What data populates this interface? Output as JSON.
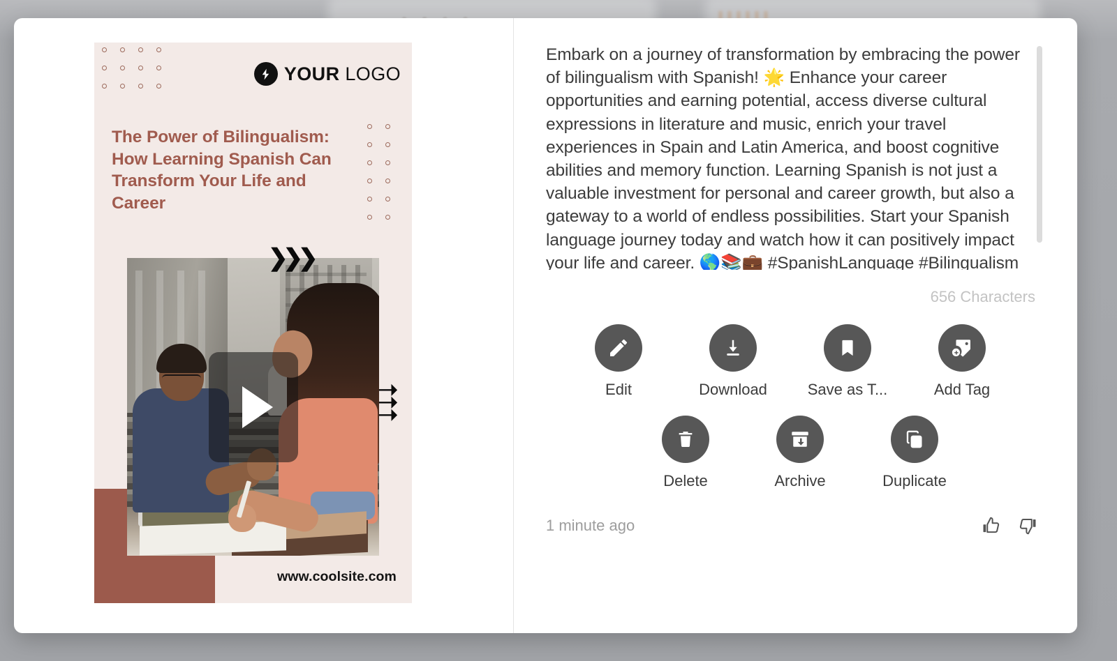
{
  "poster": {
    "logo": {
      "icon": "bolt-circle-icon",
      "bold_word": "YOUR",
      "light_word": "LOGO"
    },
    "headline": "The Power of Bilingualism: How Learning Spanish Can Transform Your Life and Career",
    "url": "www.coolsite.com",
    "play_button_label": "play-video",
    "colors": {
      "background": "#f3eae7",
      "headline": "#a05b4e",
      "block": "#9c5a4c",
      "dots": "#9c6a5c"
    }
  },
  "caption": {
    "text": "Embark on a journey of transformation by embracing the power of bilingualism with Spanish! 🌟 Enhance your career opportunities and earning potential, access diverse cultural expressions in literature and music, enrich your travel experiences in Spain and Latin America, and boost cognitive abilities and memory function. Learning Spanish is not just a valuable investment for personal and career growth, but also a gateway to a world of endless possibilities. Start your Spanish language journey today and watch how it can positively impact your life and career. 🌎📚💼 #SpanishLanguage #Bilingualism #CareerGrowth #PersonalDevelopment",
    "character_count": "656 Characters"
  },
  "actions": {
    "row1": [
      {
        "label": "Edit",
        "icon": "pencil-icon"
      },
      {
        "label": "Download",
        "icon": "download-icon"
      },
      {
        "label": "Save as T...",
        "icon": "bookmark-icon"
      },
      {
        "label": "Add Tag",
        "icon": "add-tag-icon"
      }
    ],
    "row2": [
      {
        "label": "Delete",
        "icon": "trash-icon"
      },
      {
        "label": "Archive",
        "icon": "archive-icon"
      },
      {
        "label": "Duplicate",
        "icon": "duplicate-icon"
      }
    ]
  },
  "footer": {
    "timestamp": "1 minute ago",
    "thumbs_up_icon": "thumbs-up-icon",
    "thumbs_down_icon": "thumbs-down-icon"
  }
}
